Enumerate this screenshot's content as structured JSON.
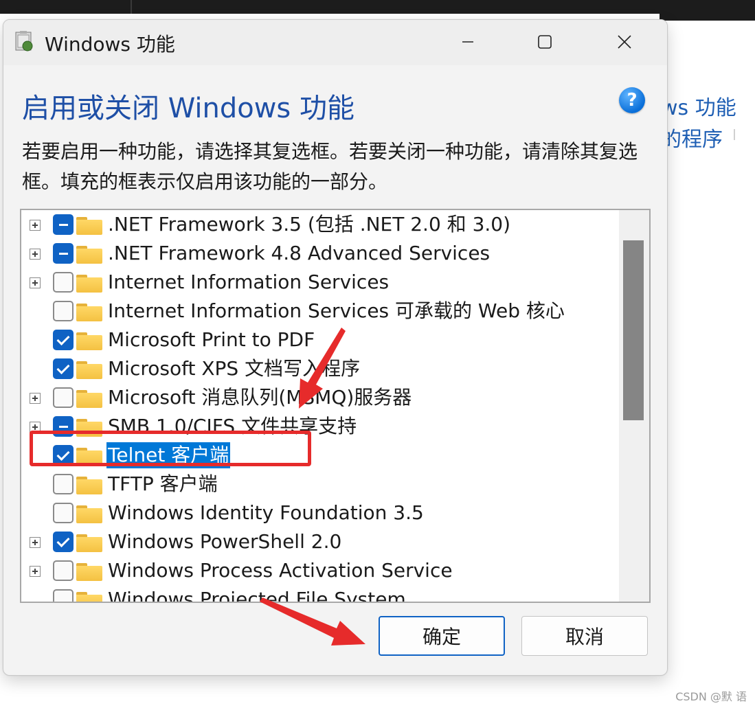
{
  "background_app": {
    "link1": "ws 功能",
    "link2": "的程序",
    "watermark": "CSDN @默  语"
  },
  "dialog": {
    "title": "Windows 功能",
    "heading": "启用或关闭 Windows 功能",
    "description": "若要启用一种功能，请选择其复选框。若要关闭一种功能，请清除其复选框。填充的框表示仅启用该功能的一部分。",
    "help_icon": "?",
    "features": [
      {
        "label": ".NET Framework 3.5 (包括 .NET 2.0 和 3.0)",
        "state": "partial",
        "expandable": true
      },
      {
        "label": ".NET Framework 4.8 Advanced Services",
        "state": "partial",
        "expandable": true
      },
      {
        "label": "Internet Information Services",
        "state": "unchecked",
        "expandable": true
      },
      {
        "label": "Internet Information Services 可承载的 Web 核心",
        "state": "unchecked",
        "expandable": false
      },
      {
        "label": "Microsoft Print to PDF",
        "state": "checked",
        "expandable": false
      },
      {
        "label": "Microsoft XPS 文档写入程序",
        "state": "checked",
        "expandable": false
      },
      {
        "label": "Microsoft 消息队列(MSMQ)服务器",
        "state": "unchecked",
        "expandable": true
      },
      {
        "label": "SMB 1.0/CIFS 文件共享支持",
        "state": "partial",
        "expandable": true
      },
      {
        "label": "Telnet 客户端",
        "state": "checked",
        "expandable": false,
        "selected": true
      },
      {
        "label": "TFTP 客户端",
        "state": "unchecked",
        "expandable": false
      },
      {
        "label": "Windows Identity Foundation 3.5",
        "state": "unchecked",
        "expandable": false
      },
      {
        "label": "Windows PowerShell 2.0",
        "state": "checked",
        "expandable": true
      },
      {
        "label": "Windows Process Activation Service",
        "state": "unchecked",
        "expandable": true
      },
      {
        "label": "Windows Projected File System",
        "state": "unchecked",
        "expandable": false
      }
    ],
    "ok_label": "确定",
    "cancel_label": "取消"
  },
  "colors": {
    "accent": "#0f62c4",
    "heading": "#1e4fa6",
    "annotation_red": "#e62b2b",
    "selection": "#0078d7"
  }
}
